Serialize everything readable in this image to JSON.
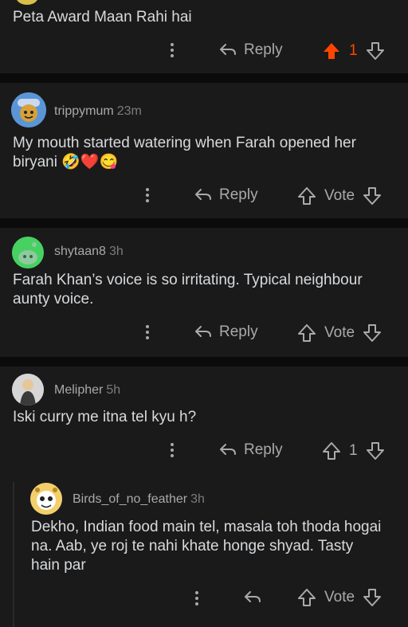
{
  "comments": [
    {
      "text": "Peta Award Maan Rahi hai",
      "reply_label": "Reply",
      "vote_value": "1",
      "upvoted": true,
      "accent_color": "#ff4500"
    },
    {
      "username": "trippymum",
      "time": "23m",
      "text": "My mouth started watering when Farah opened her biryani 🤣❤️😋",
      "reply_label": "Reply",
      "vote_value": "Vote"
    },
    {
      "username": "shytaan8",
      "time": "3h",
      "text": "Farah Khan’s voice is so irritating. Typical neighbour aunty voice.",
      "reply_label": "Reply",
      "vote_value": "Vote"
    },
    {
      "username": "Melipher",
      "time": "5h",
      "text": "Iski curry me itna tel kyu h?",
      "reply_label": "Reply",
      "vote_value": "1"
    },
    {
      "username": "Birds_of_no_feather",
      "time": "3h",
      "text": "Dekho, Indian food main tel, masala toh thoda hogai na. Aab, ye roj te nahi khate honge shyad. Tasty hain par",
      "vote_value": "Vote"
    }
  ],
  "icons": {
    "more": "more-vertical-icon",
    "reply": "reply-arrow-icon",
    "up": "arrow-up-icon",
    "down": "arrow-down-icon"
  }
}
